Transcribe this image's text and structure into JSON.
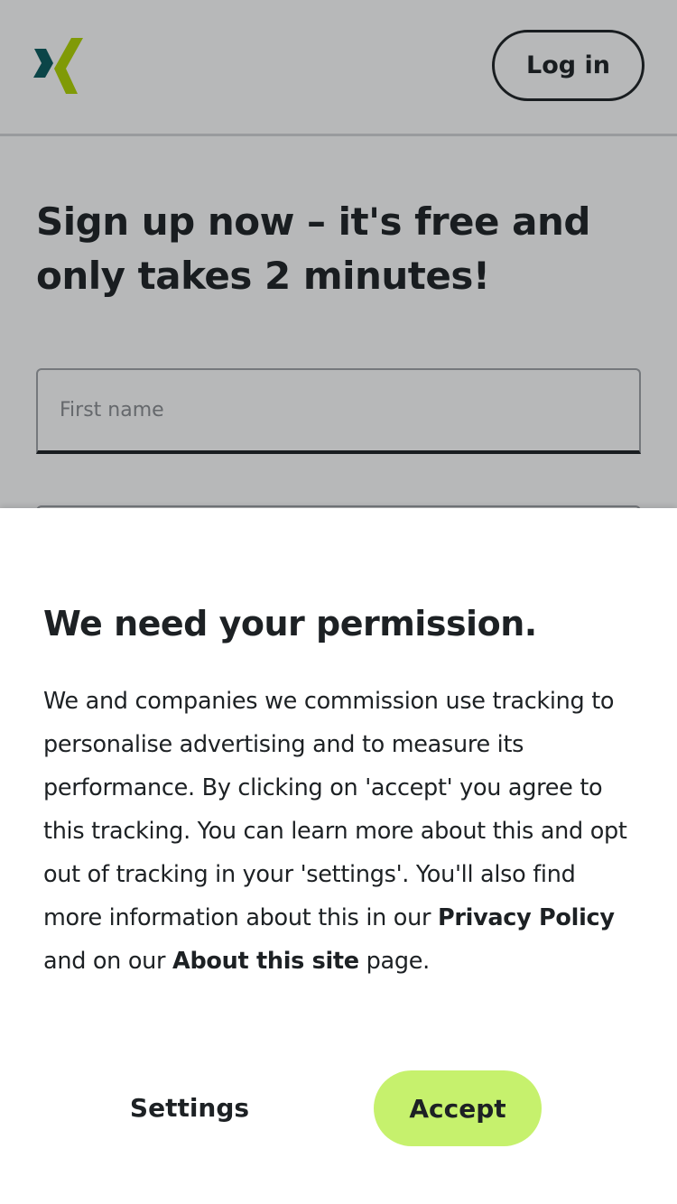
{
  "header": {
    "logo_name": "xing-logo",
    "login_label": "Log in"
  },
  "signup": {
    "title": "Sign up now – it's free and only takes 2 minutes!",
    "first_name_placeholder": "First name"
  },
  "consent": {
    "title": "We need your permission.",
    "body_part1": "We and companies we commission use tracking to personalise advertising and to measure its performance. By clicking on 'accept' you agree to this tracking. You can learn more about this and opt out of tracking in your 'settings'. You'll also find more information about this in our ",
    "privacy_link": "Privacy Policy",
    "body_part2": " and on our ",
    "about_link": "About this site",
    "body_part3": " page.",
    "settings_label": "Settings",
    "accept_label": "Accept"
  },
  "colors": {
    "accent": "#c6f16d",
    "logo_teal": "#0a5b5e",
    "logo_green": "#b0d400",
    "text": "#1d2124"
  }
}
